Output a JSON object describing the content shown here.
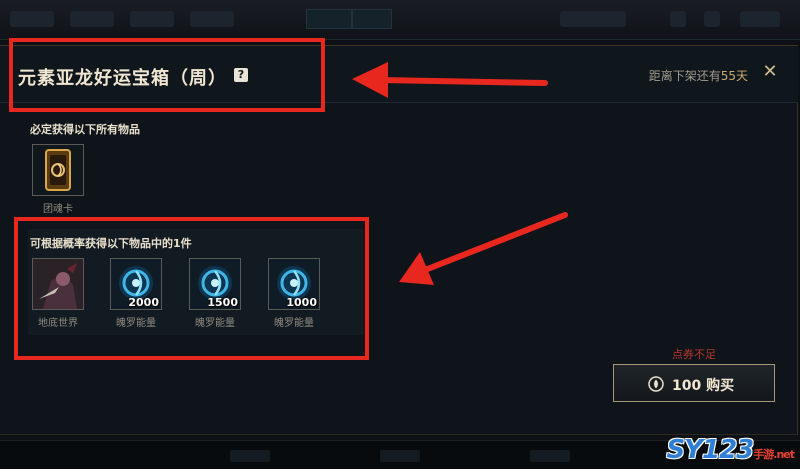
{
  "modal": {
    "title": "元素亚龙好运宝箱（周）",
    "help_icon_char": "?",
    "remaining_prefix": "距离下架还有",
    "remaining_days": "55天",
    "close_char": "✕"
  },
  "guaranteed": {
    "label": "必定获得以下所有物品",
    "items": [
      {
        "caption": "团魂卡",
        "icon": "team-soul-card-icon"
      }
    ]
  },
  "random": {
    "label": "可根据概率获得以下物品中的1件",
    "items": [
      {
        "caption": "地底世界",
        "qty": "",
        "icon": "skin-portrait-icon"
      },
      {
        "caption": "魄罗能量",
        "qty": "2000",
        "icon": "poro-energy-icon"
      },
      {
        "caption": "魄罗能量",
        "qty": "1500",
        "icon": "poro-energy-icon"
      },
      {
        "caption": "魄罗能量",
        "qty": "1000",
        "icon": "poro-energy-icon"
      }
    ]
  },
  "purchase": {
    "warning": "点券不足",
    "button_label": "100 购买",
    "coin_icon": "coupon-icon"
  },
  "watermark": {
    "text": "SY123",
    "sub": "手游.net"
  },
  "colors": {
    "gold": "#c8aa6e",
    "annotation_red": "#e8271f",
    "warning_red": "#b8352a"
  }
}
